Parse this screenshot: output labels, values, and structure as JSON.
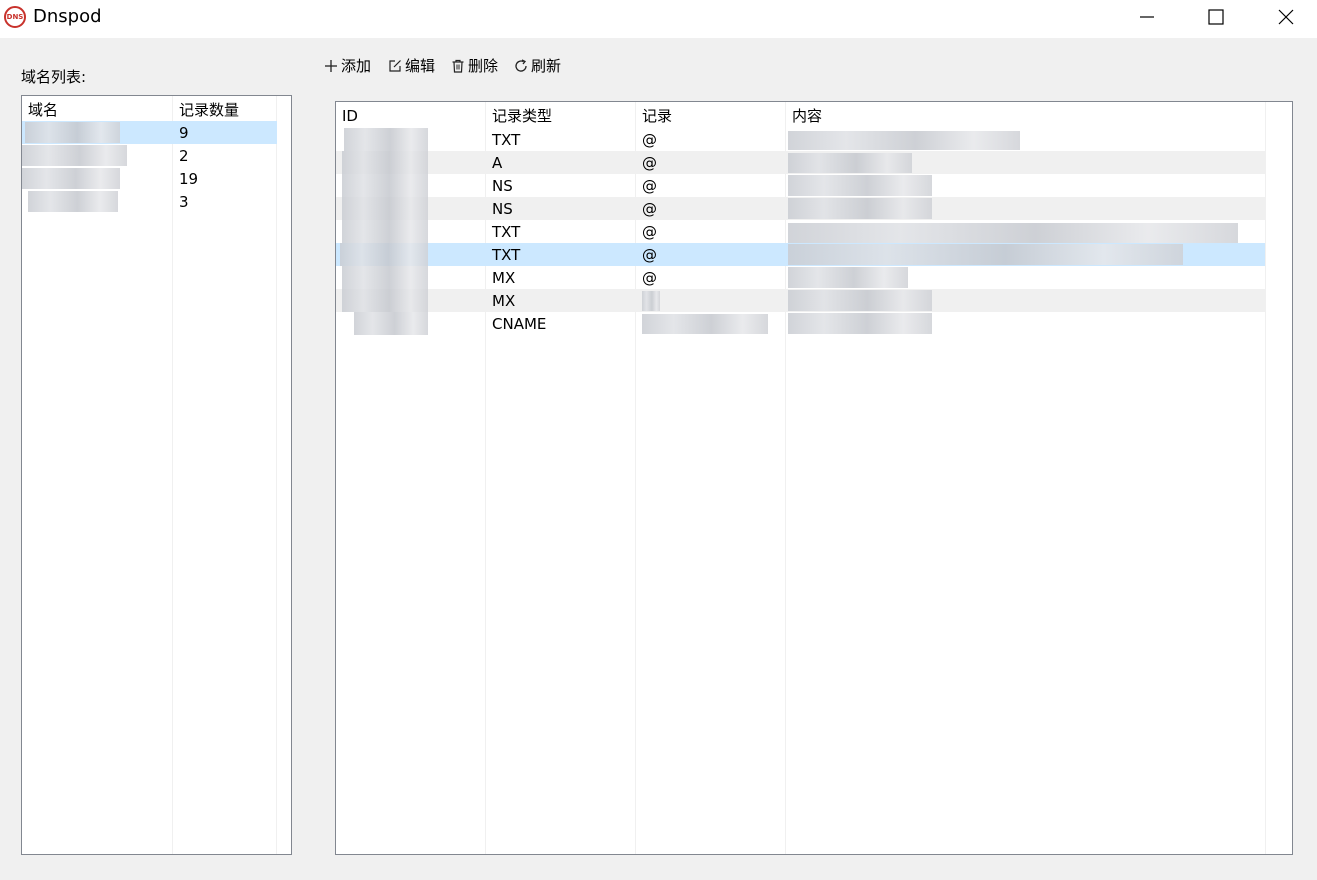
{
  "window": {
    "title": "Dnspod",
    "icon_text": "DNS",
    "icon": "dns-logo-icon",
    "controls": [
      "minimize-icon",
      "maximize-icon",
      "close-icon"
    ]
  },
  "domain_panel": {
    "label": "域名列表:",
    "columns": [
      "域名",
      "记录数量"
    ],
    "rows": [
      {
        "count": "9",
        "selected": true
      },
      {
        "count": "2",
        "selected": false
      },
      {
        "count": "19",
        "selected": false
      },
      {
        "count": "3",
        "selected": false
      }
    ]
  },
  "toolbar": {
    "add": {
      "label": "添加",
      "icon": "plus-icon"
    },
    "edit": {
      "label": "编辑",
      "icon": "edit-icon"
    },
    "delete": {
      "label": "删除",
      "icon": "trash-icon"
    },
    "refresh": {
      "label": "刷新",
      "icon": "refresh-icon"
    }
  },
  "record_table": {
    "columns": [
      "ID",
      "记录类型",
      "记录",
      "内容"
    ],
    "rows": [
      {
        "type": "TXT",
        "record": "@"
      },
      {
        "type": "A",
        "record": "@"
      },
      {
        "type": "NS",
        "record": "@"
      },
      {
        "type": "NS",
        "record": "@"
      },
      {
        "type": "TXT",
        "record": "@"
      },
      {
        "type": "TXT",
        "record": "@",
        "selected": true
      },
      {
        "type": "MX",
        "record": "@"
      },
      {
        "type": "MX",
        "record": ""
      },
      {
        "type": "CNAME",
        "record": ""
      }
    ]
  },
  "colors": {
    "selection": "#cce8ff",
    "window_bg": "#f0f0f0",
    "border": "#828790",
    "icon_red": "#c8322c"
  }
}
